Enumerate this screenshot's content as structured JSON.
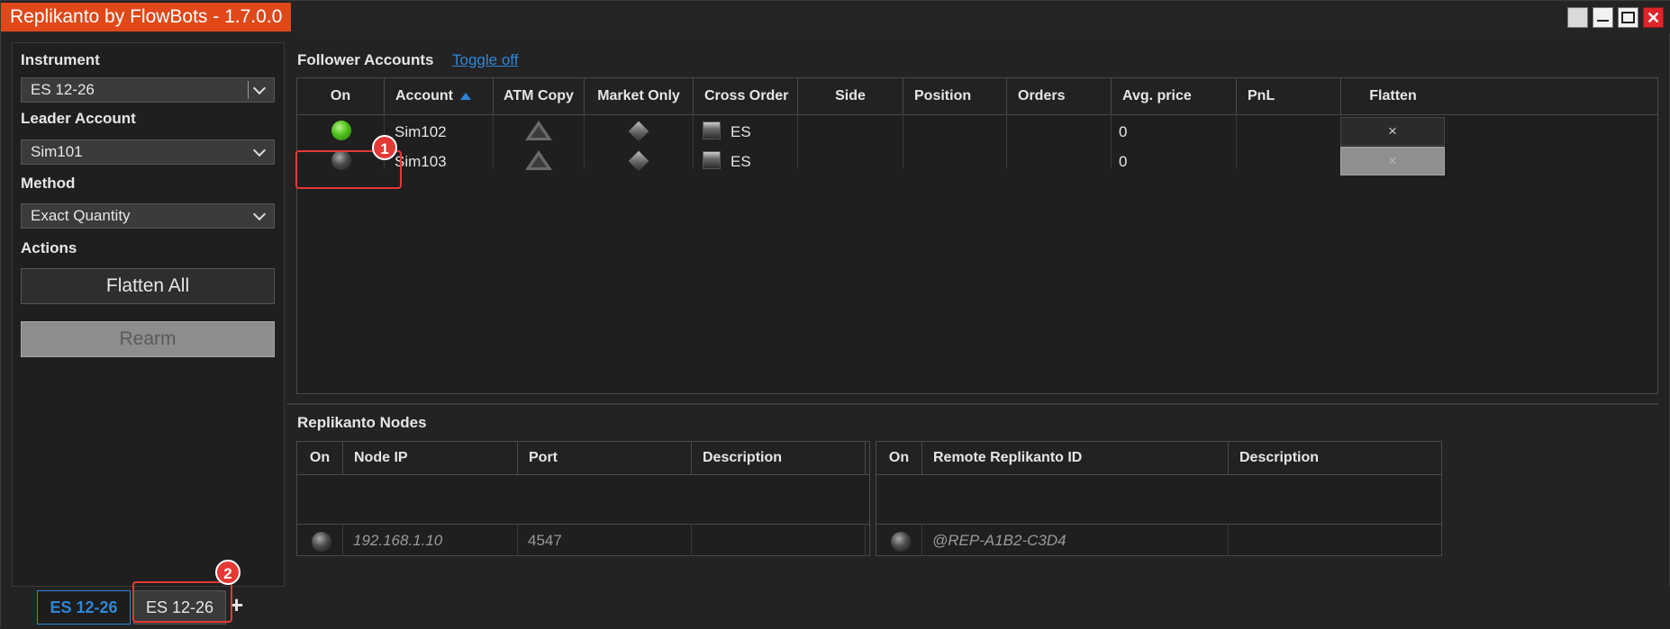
{
  "window": {
    "title": "Replikanto by FlowBots - 1.7.0.0"
  },
  "left_panel": {
    "instrument_label": "Instrument",
    "instrument_value": "ES 12-26",
    "leader_label": "Leader Account",
    "leader_value": "Sim101",
    "method_label": "Method",
    "method_value": "Exact Quantity",
    "actions_label": "Actions",
    "flatten_all_label": "Flatten All",
    "rearm_label": "Rearm"
  },
  "followers": {
    "title": "Follower Accounts",
    "toggle_link": "Toggle off",
    "columns": [
      "On",
      "Account",
      "ATM Copy",
      "Market Only",
      "Cross Order",
      "Side",
      "Position",
      "Orders",
      "Avg. price",
      "PnL",
      "Flatten"
    ],
    "rows": [
      {
        "on": true,
        "account": "Sim102",
        "cross_order": "ES",
        "side": "",
        "position": "",
        "orders": "",
        "avg_price": "0",
        "pnl": "",
        "flatten": "×"
      },
      {
        "on": false,
        "account": "Sim103",
        "cross_order": "ES",
        "side": "",
        "position": "",
        "orders": "",
        "avg_price": "0",
        "pnl": "",
        "flatten": "×"
      }
    ]
  },
  "nodes": {
    "title": "Replikanto Nodes",
    "left_columns": [
      "On",
      "Node IP",
      "Port",
      "Description"
    ],
    "left_row": {
      "on": false,
      "node_ip": "192.168.1.10",
      "port": "4547",
      "description": ""
    },
    "right_columns": [
      "On",
      "Remote Replikanto ID",
      "Description"
    ],
    "right_row": {
      "on": false,
      "remote_id": "@REP-A1B2-C3D4",
      "description": ""
    }
  },
  "tabs": [
    {
      "label": "ES 12-26",
      "active": true
    },
    {
      "label": "ES 12-26",
      "active": false
    }
  ],
  "add_tab_label": "+",
  "annotations": [
    "1",
    "2"
  ],
  "colors": {
    "title_bg": "#e0481a",
    "accent": "#2f86d6",
    "annotation": "#e53935",
    "led_on": "#4fc01c"
  }
}
